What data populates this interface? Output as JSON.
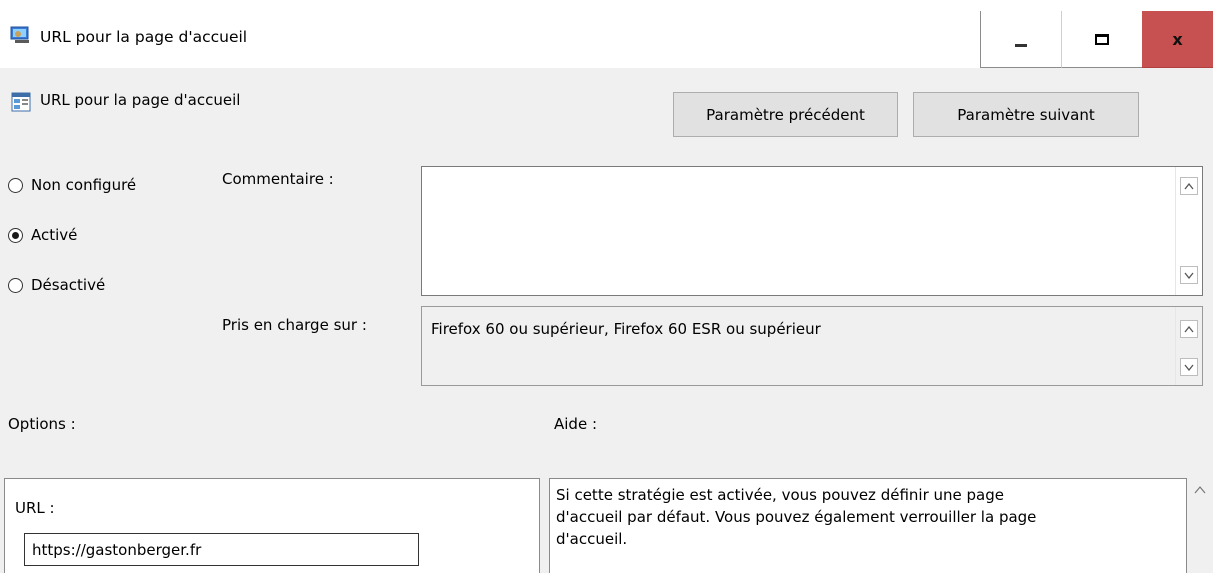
{
  "window": {
    "title": "URL pour la page d'accueil",
    "icon": "group-policy-editor-icon",
    "controls": {
      "minimize_icon": "minimize-icon",
      "maximize_icon": "maximize-icon",
      "close_label": "x"
    }
  },
  "policy": {
    "name": "URL pour la page d'accueil",
    "icon": "policy-setting-icon"
  },
  "nav": {
    "prev_label": "Paramètre précédent",
    "next_label": "Paramètre suivant"
  },
  "state": {
    "options": [
      {
        "label": "Non configuré",
        "checked": false
      },
      {
        "label": "Activé",
        "checked": true
      },
      {
        "label": "Désactivé",
        "checked": false
      }
    ]
  },
  "comment": {
    "label": "Commentaire :",
    "value": ""
  },
  "supported": {
    "label": "Pris en charge sur :",
    "value": "Firefox 60 ou supérieur, Firefox 60 ESR ou supérieur"
  },
  "options_panel": {
    "heading": "Options :",
    "url_label": "URL :",
    "url_value": "https://gastonberger.fr"
  },
  "help_panel": {
    "heading": "Aide :",
    "lines": [
      "Si cette stratégie est activée, vous pouvez définir une page",
      "d'accueil par défaut. Vous pouvez également verrouiller la page",
      "d'accueil."
    ]
  },
  "colors": {
    "window_bg": "#f0f0f0",
    "close_button": "#c75050",
    "button_bg": "#e1e1e1"
  }
}
